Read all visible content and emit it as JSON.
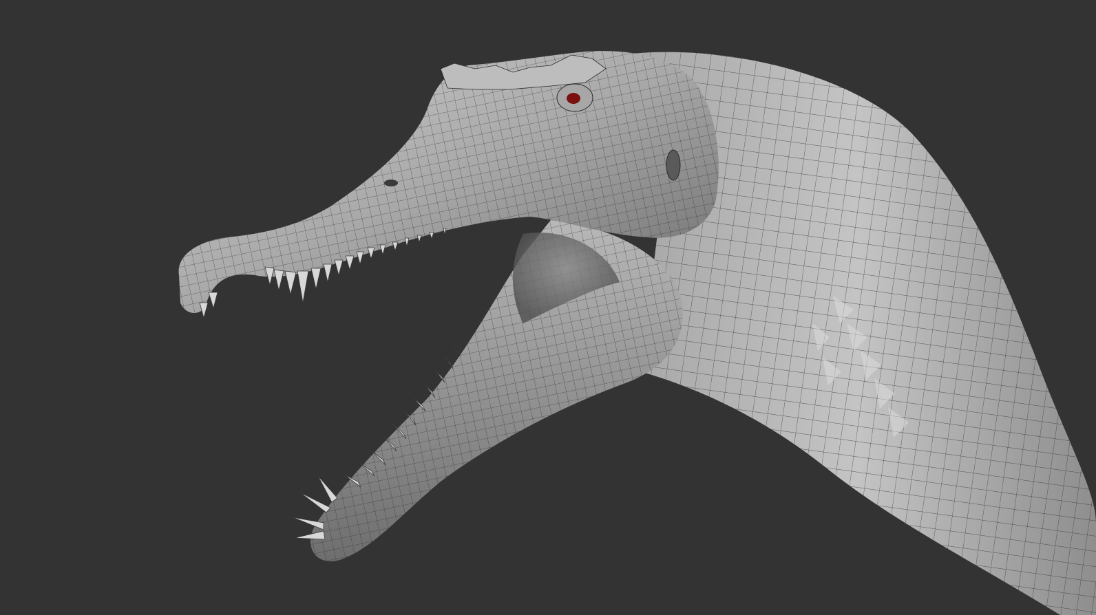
{
  "scene": {
    "subject_icon": "dinosaur-head-wireframe-icon",
    "colors": {
      "background": "#333333",
      "mesh_light": "#c9c9c9",
      "mesh_mid": "#9a9a9a",
      "mesh_dark": "#555555",
      "wire": "#2a2a2a",
      "eye": "#7a1010",
      "teeth": "#d8d8d8"
    }
  }
}
